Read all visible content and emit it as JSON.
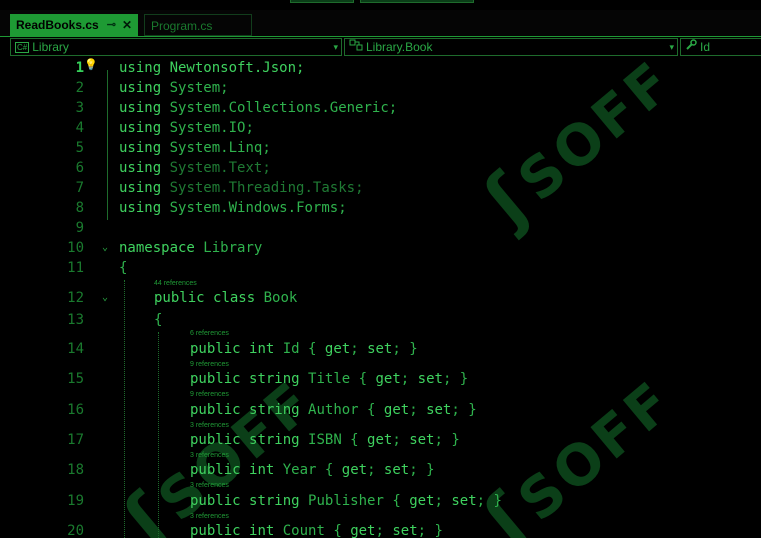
{
  "tabs": {
    "active": {
      "label": "ReadBooks.cs",
      "pin_glyph": "⊸",
      "close_glyph": "✕"
    },
    "inactive": {
      "label": "Program.cs"
    }
  },
  "navbar": {
    "project": "Library",
    "type": "Library.Book",
    "member": "Id",
    "dropdown_glyph": "▾"
  },
  "watermark": {
    "text": "SOFF"
  },
  "lines": [
    {
      "n": "1",
      "text": "using Newtonsoft.Json;"
    },
    {
      "n": "2",
      "text": "using System;"
    },
    {
      "n": "3",
      "text": "using System.Collections.Generic;"
    },
    {
      "n": "4",
      "text": "using System.IO;"
    },
    {
      "n": "5",
      "text": "using System.Linq;"
    },
    {
      "n": "6",
      "text": "using System.Text;"
    },
    {
      "n": "7",
      "text": "using System.Threading.Tasks;"
    },
    {
      "n": "8",
      "text": "using System.Windows.Forms;"
    },
    {
      "n": "9",
      "text": ""
    },
    {
      "n": "10",
      "text": "namespace Library"
    },
    {
      "n": "11",
      "text": "{"
    },
    {
      "n": "12",
      "text": "public class Book",
      "refs": "44 references"
    },
    {
      "n": "13",
      "text": "{"
    },
    {
      "n": "14",
      "text": "public int Id { get; set; }",
      "refs": "6 references"
    },
    {
      "n": "15",
      "text": "public string Title { get; set; }",
      "refs": "9 references"
    },
    {
      "n": "16",
      "text": "public string Author { get; set; }",
      "refs": "9 references"
    },
    {
      "n": "17",
      "text": "public string ISBN { get; set; }",
      "refs": "3 references"
    },
    {
      "n": "18",
      "text": "public int Year { get; set; }",
      "refs": "3 references"
    },
    {
      "n": "19",
      "text": "public string Publisher { get; set; }",
      "refs": "3 references"
    },
    {
      "n": "20",
      "text": "public int Count { get; set; }",
      "refs": "3 references"
    }
  ],
  "colors": {
    "accent": "#1e9a34",
    "keyword": "#3fd25f",
    "text": "#2fb24d",
    "background": "#000000"
  },
  "icons": [
    "pin-icon",
    "close-icon",
    "csharp-file-icon",
    "class-icon",
    "wrench-icon",
    "lightbulb-icon",
    "fold-chevron-icon"
  ]
}
